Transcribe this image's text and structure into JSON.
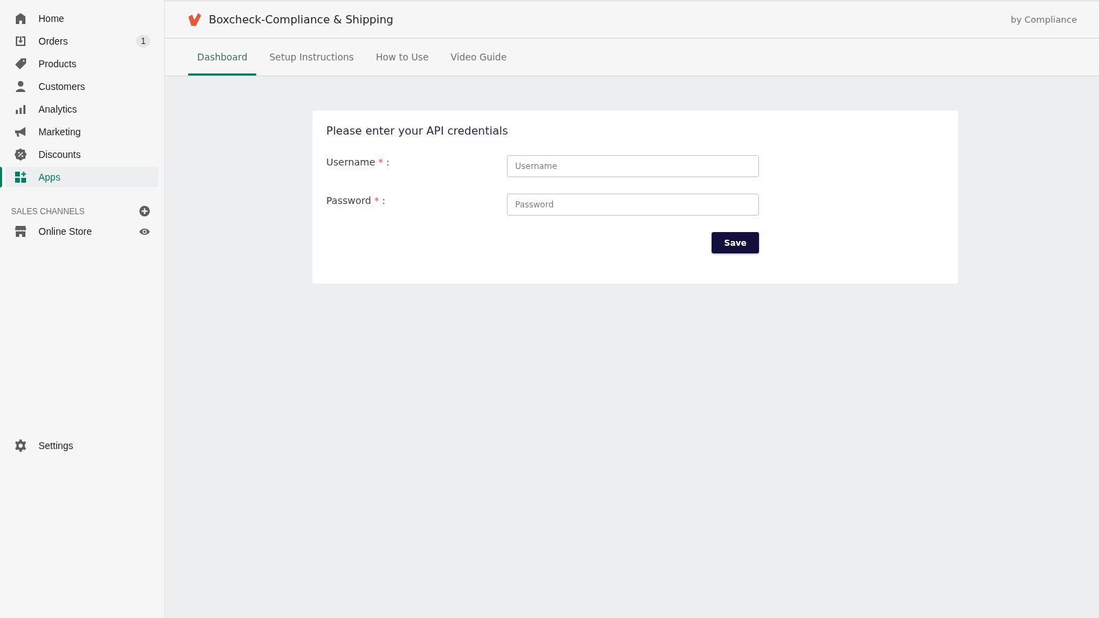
{
  "sidebar": {
    "items": [
      {
        "label": "Home",
        "selected": false
      },
      {
        "label": "Orders",
        "selected": false,
        "badge": "1"
      },
      {
        "label": "Products",
        "selected": false
      },
      {
        "label": "Customers",
        "selected": false
      },
      {
        "label": "Analytics",
        "selected": false
      },
      {
        "label": "Marketing",
        "selected": false
      },
      {
        "label": "Discounts",
        "selected": false
      },
      {
        "label": "Apps",
        "selected": true
      }
    ],
    "sales_channels": {
      "heading": "SALES CHANNELS",
      "items": [
        {
          "label": "Online Store",
          "selected": false
        }
      ]
    },
    "settings": {
      "label": "Settings"
    }
  },
  "header": {
    "title": "Boxcheck-Compliance & Shipping",
    "byline": "by Compliance"
  },
  "tabs": [
    {
      "label": "Dashboard",
      "selected": true
    },
    {
      "label": "Setup Instructions",
      "selected": false
    },
    {
      "label": "How to Use",
      "selected": false
    },
    {
      "label": "Video Guide",
      "selected": false
    }
  ],
  "card": {
    "title": "Please enter your API credentials",
    "fields": [
      {
        "label": "Username",
        "required_mark": "*",
        "separator": ":",
        "placeholder": "Username"
      },
      {
        "label": "Password",
        "required_mark": "*",
        "separator": ":",
        "placeholder": "Password"
      }
    ],
    "button": "Save"
  }
}
